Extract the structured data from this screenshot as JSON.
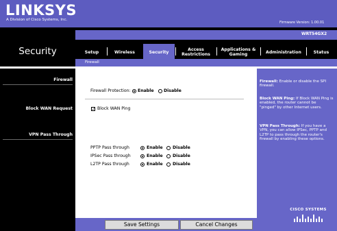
{
  "header": {
    "logo": "LINKSYS",
    "logo_sub": "A Division of Cisco Systems, Inc.",
    "firmware": "Firmware Version: 1.00.01",
    "model": "WRT54GX2"
  },
  "page": {
    "title": "Security"
  },
  "tabs": [
    {
      "label": "Setup",
      "active": false
    },
    {
      "label": "Wireless",
      "active": false
    },
    {
      "label": "Security",
      "active": true
    },
    {
      "label_line1": "Access",
      "label_line2": "Restrictions",
      "active": false
    },
    {
      "label_line1": "Applications &",
      "label_line2": "Gaming",
      "active": false
    },
    {
      "label": "Administration",
      "active": false
    },
    {
      "label": "Status",
      "active": false
    }
  ],
  "subtabs": [
    {
      "label": "Firewall",
      "active": true
    }
  ],
  "sections": {
    "firewall": "Firewall",
    "block_wan": "Block WAN Request",
    "vpn": "VPN Pass Through"
  },
  "form": {
    "firewall_protection": {
      "label": "Firewall Protection:",
      "options": [
        "Enable",
        "Disable"
      ],
      "selected": "Enable"
    },
    "block_wan_ping": {
      "label": "Block WAN Ping",
      "checked": true
    },
    "vpn": [
      {
        "label": "PPTP Pass through",
        "options": [
          "Enable",
          "Disable"
        ],
        "selected": "Enable"
      },
      {
        "label": "IPSec Pass through",
        "options": [
          "Enable",
          "Disable"
        ],
        "selected": "Enable"
      },
      {
        "label": "L2TP Pass through",
        "options": [
          "Enable",
          "Disable"
        ],
        "selected": "Enable"
      }
    ]
  },
  "help": {
    "firewall_title": "Firewall:",
    "firewall_body": "Enable or disable the SPI firewall.",
    "block_title": "Block WAN Ping:",
    "block_body": "If Block WAN Ping is enabled, the router cannot be \"pinged\" by other Internet users.",
    "vpn_title": "VPN Pass Through:",
    "vpn_body": "If you have a VPN, you can allow IPSec, PPTP and L2TP to pass through the router's firewall by enabling these options."
  },
  "footer": {
    "save_label": "Save Settings",
    "cancel_label": "Cancel Changes"
  },
  "brand": {
    "cisco": "CISCO SYSTEMS"
  },
  "colors": {
    "accent": "#6766c8",
    "header": "#5d5cc0",
    "nav": "#000000"
  }
}
